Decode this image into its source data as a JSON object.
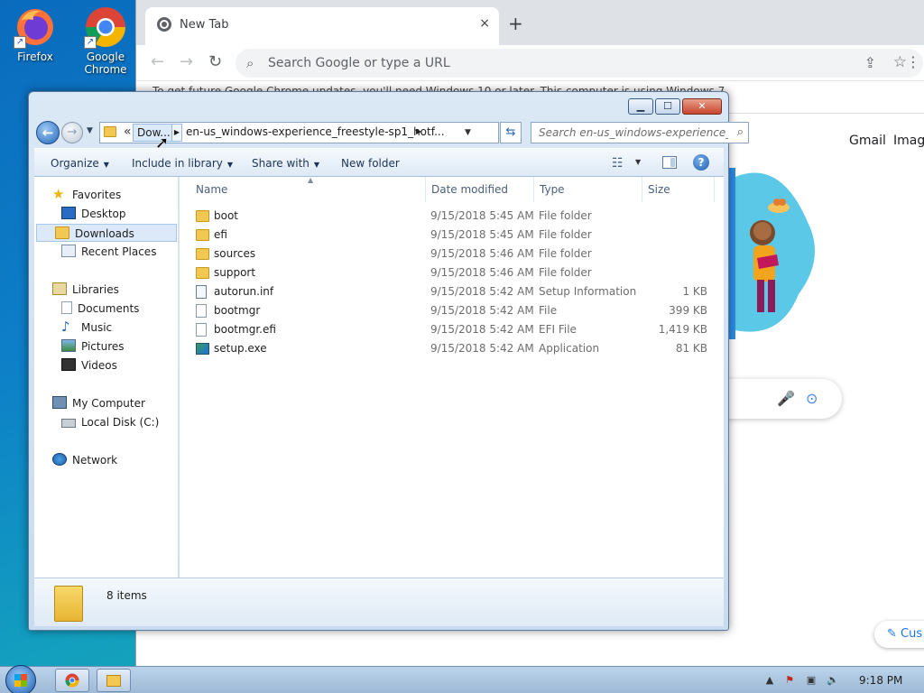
{
  "desktop": {
    "icons": [
      {
        "label": "Firefox"
      },
      {
        "label": "Google Chrome"
      }
    ]
  },
  "chrome": {
    "tab_title": "New Tab",
    "tab_close": "×",
    "new_tab": "+",
    "omnibox_placeholder": "Search Google or type a URL",
    "info_text": "To get future Google Chrome updates, you'll need Windows 10 or later. This computer is using Windows 7.",
    "links": {
      "gmail": "Gmail",
      "images": "Image"
    },
    "customize_label": "✎ Cus"
  },
  "explorer": {
    "address": {
      "overflow": "«",
      "crumb1": "Dow...",
      "crumb2": "en-us_windows-experience_freestyle-sp1_hotf..."
    },
    "search_placeholder": "Search en-us_windows-experience_fre...",
    "commands": {
      "organize": "Organize",
      "include_in_library": "Include in library",
      "share_with": "Share with",
      "new_folder": "New folder"
    },
    "nav": {
      "favorites": "Favorites",
      "desktop": "Desktop",
      "downloads": "Downloads",
      "recent_places": "Recent Places",
      "libraries": "Libraries",
      "documents": "Documents",
      "music": "Music",
      "pictures": "Pictures",
      "videos": "Videos",
      "my_computer": "My Computer",
      "local_disk": "Local Disk (C:)",
      "network": "Network"
    },
    "columns": {
      "name": "Name",
      "date": "Date modified",
      "type": "Type",
      "size": "Size"
    },
    "files": [
      {
        "name": "boot",
        "date": "9/15/2018 5:45 AM",
        "type": "File folder",
        "size": "",
        "icon": "folder"
      },
      {
        "name": "efi",
        "date": "9/15/2018 5:45 AM",
        "type": "File folder",
        "size": "",
        "icon": "folder"
      },
      {
        "name": "sources",
        "date": "9/15/2018 5:46 AM",
        "type": "File folder",
        "size": "",
        "icon": "folder"
      },
      {
        "name": "support",
        "date": "9/15/2018 5:46 AM",
        "type": "File folder",
        "size": "",
        "icon": "folder"
      },
      {
        "name": "autorun.inf",
        "date": "9/15/2018 5:42 AM",
        "type": "Setup Information",
        "size": "1 KB",
        "icon": "inf"
      },
      {
        "name": "bootmgr",
        "date": "9/15/2018 5:42 AM",
        "type": "File",
        "size": "399 KB",
        "icon": "file"
      },
      {
        "name": "bootmgr.efi",
        "date": "9/15/2018 5:42 AM",
        "type": "EFI File",
        "size": "1,419 KB",
        "icon": "file"
      },
      {
        "name": "setup.exe",
        "date": "9/15/2018 5:42 AM",
        "type": "Application",
        "size": "81 KB",
        "icon": "exe"
      }
    ],
    "status": {
      "items_count": "8 items"
    }
  },
  "taskbar": {
    "clock": "9:18 PM"
  }
}
